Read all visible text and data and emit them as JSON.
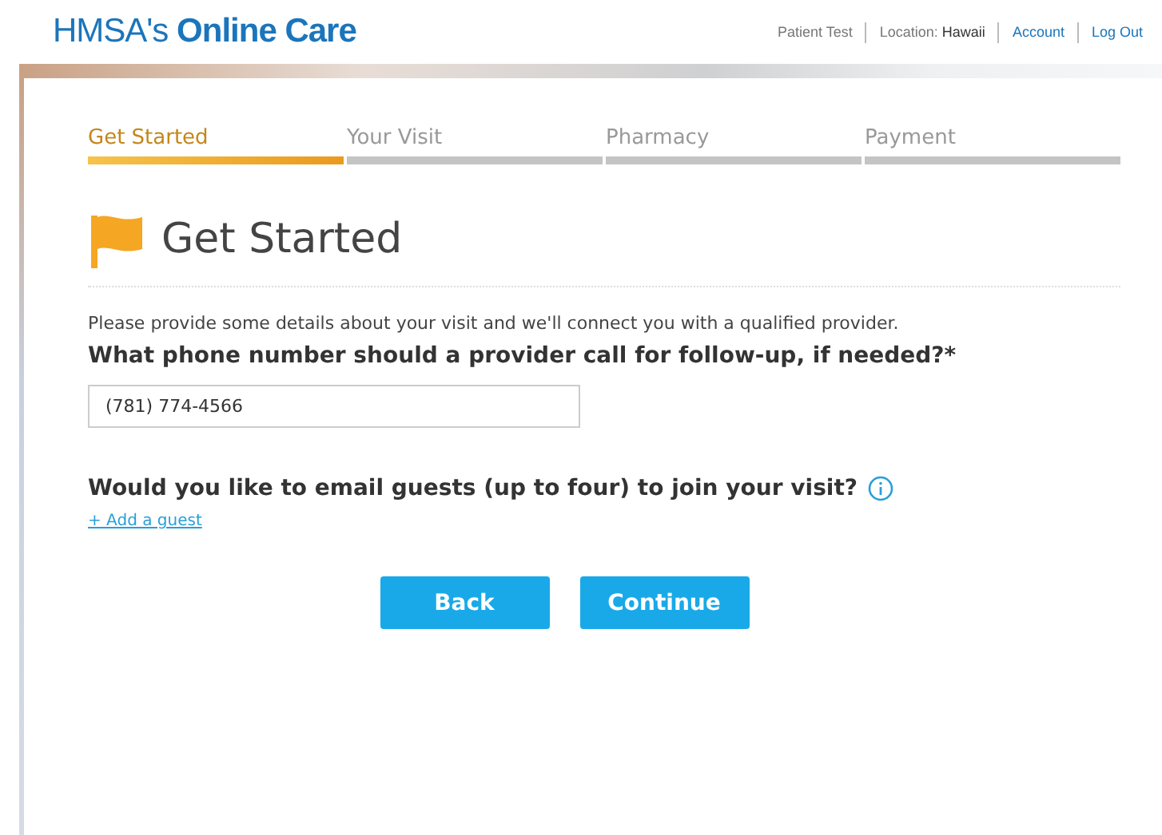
{
  "header": {
    "logo": {
      "prefix": "HMSA's",
      "name": "Online Care"
    },
    "links": [
      {
        "label": "Patient Test",
        "kind": "text"
      },
      {
        "label": "Location:",
        "value": "Hawaii",
        "kind": "location"
      },
      {
        "label": "Account",
        "kind": "link"
      },
      {
        "label": "Log Out",
        "kind": "link"
      }
    ]
  },
  "steps": [
    {
      "label": "Get Started",
      "selected": true
    },
    {
      "label": "Your Visit",
      "selected": false
    },
    {
      "label": "Pharmacy",
      "selected": false
    },
    {
      "label": "Payment",
      "selected": false
    }
  ],
  "page_title": "Get Started",
  "intro": "Please provide some details about your visit and we'll connect you with a qualified provider.",
  "phone_question": "What phone number should a provider call for follow-up, if needed?*",
  "phone_field": {
    "value": "(781) 774-4566"
  },
  "guests_question": "Would you like to email guests (up to four) to join your visit?",
  "add_guest_link": "+ Add a guest",
  "buttons": [
    "Back",
    "Continue"
  ]
}
